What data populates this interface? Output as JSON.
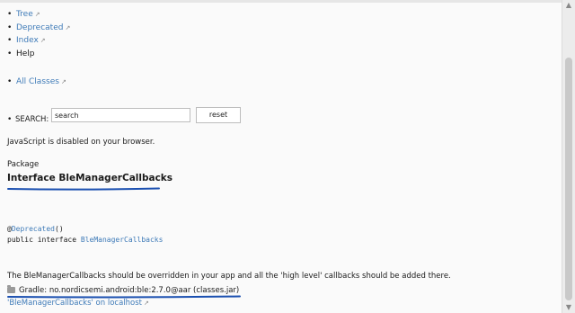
{
  "nav": [
    {
      "label": "Tree",
      "external": true
    },
    {
      "label": "Deprecated",
      "external": true
    },
    {
      "label": "Index",
      "external": true
    },
    {
      "label": "Help",
      "external": false
    }
  ],
  "all_classes": "All Classes",
  "search": {
    "label": "SEARCH:",
    "value": "search",
    "reset_label": "reset"
  },
  "js_disabled": "JavaScript is disabled on your browser.",
  "package_label": "Package",
  "interface_title": "Interface BleManagerCallbacks",
  "code": {
    "line1_prefix": "@",
    "line1_link": "Deprecated",
    "line1_suffix": "()",
    "line2_prefix": "public interface ",
    "line2_link": "BleManagerCallbacks"
  },
  "description": "The BleManagerCallbacks should be overridden in your app and all the 'high level' callbacks should be added there.",
  "gradle": "Gradle: no.nordicsemi.android:ble:2.7.0@aar (classes.jar)",
  "footer_link": "'BleManagerCallbacks' on localhost",
  "colors": {
    "link": "#3f7bb8",
    "annotation": "#1a4fb0"
  }
}
